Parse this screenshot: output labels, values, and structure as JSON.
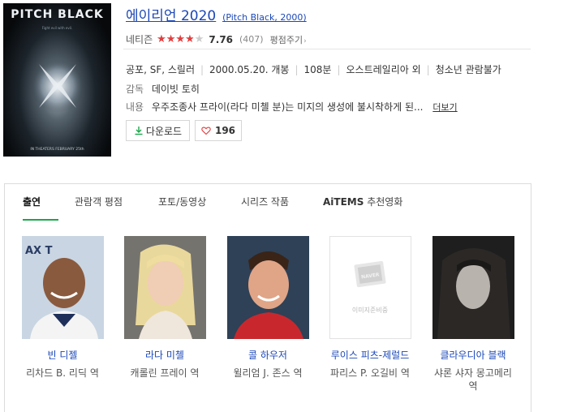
{
  "poster": {
    "title": "PITCH BLACK",
    "tagline": "Fight evil with evil.",
    "footer": "IN THEATERS FEBRUARY 25th"
  },
  "movie": {
    "title": "에이리언 2020",
    "subtitle": "(Pitch Black, 2000)"
  },
  "rating": {
    "label": "네티즌",
    "stars_fraction": 0.775,
    "score": "7.76",
    "count": "(407)",
    "rate_link": "평점주기"
  },
  "info": {
    "genre": "공포, SF, 스릴러",
    "release": "2000.05.20. 개봉",
    "runtime": "108분",
    "country": "오스트레일리아 외",
    "age_rating": "청소년 관람불가"
  },
  "director": {
    "label": "감독",
    "name": "데이빗 토히"
  },
  "plot": {
    "label": "내용",
    "text": "우주조종사 프라이(라다 미첼 분)는 미지의 생성에 불시착하게 된...",
    "more": "더보기"
  },
  "buttons": {
    "download": "다운로드",
    "likes": "196"
  },
  "tabs": [
    "출연",
    "관람객 평점",
    "포토/동영상",
    "시리즈 작품",
    "추천영화"
  ],
  "aitems_label": "AiTEMS",
  "cast": [
    {
      "name": "빈 디젤",
      "role": "리차드 B. 리딕 역"
    },
    {
      "name": "라다 미첼",
      "role": "캐롤린 프레이 역"
    },
    {
      "name": "콜 하우저",
      "role": "윌리엄 J. 존스 역"
    },
    {
      "name": "루이스 피츠-제럴드",
      "role": "파리스 P. 오길비 역"
    },
    {
      "name": "클라우디아 블랙",
      "role": "샤론 샤자 몽고메리 역"
    }
  ],
  "no_image_text": "이미지준비중",
  "naver_logo_text": "NAVER",
  "colors": {
    "link_blue": "#1b47b8",
    "star_red": "#e23f3f",
    "tab_green": "#1aa84a"
  }
}
